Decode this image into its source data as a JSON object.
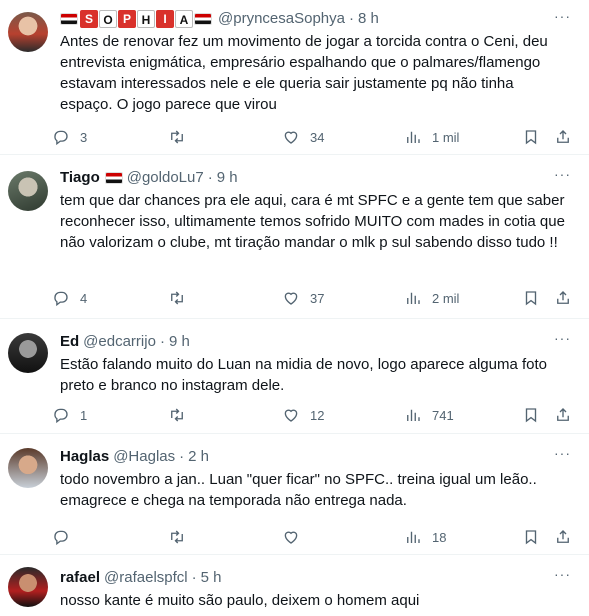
{
  "tweets": [
    {
      "name": "SOPHIA",
      "name_letters": [
        "S",
        "O",
        "P",
        "H",
        "I",
        "A"
      ],
      "handle": "@pryncesaSophya",
      "time": "8 h",
      "text": "Antes de renovar fez um movimento de jogar a torcida contra o Ceni, deu entrevista enigmática, empresário espalhando que o palmares/flamengo estavam interessados nele e ele queria sair justamente pq não tinha espaço. O jogo parece que virou",
      "replies": "3",
      "retweets": "",
      "likes": "34",
      "views": "1 mil"
    },
    {
      "name": "Tiago",
      "handle": "@goldoLu7",
      "time": "9 h",
      "text": "tem que dar chances pra ele aqui, cara é mt SPFC e a gente tem que saber reconhecer isso, ultimamente temos sofrido MUITO com mades in cotia que não valorizam o clube, mt tiração mandar o mlk p sul sabendo disso tudo !!",
      "replies": "4",
      "retweets": "",
      "likes": "37",
      "views": "2 mil"
    },
    {
      "name": "Ed",
      "handle": "@edcarrijo",
      "time": "9 h",
      "text": "Estão falando muito do Luan na midia de novo, logo aparece alguma foto preto e branco no instagram dele.",
      "replies": "1",
      "retweets": "",
      "likes": "12",
      "views": "741"
    },
    {
      "name": "Haglas",
      "handle": "@Haglas",
      "time": "2 h",
      "text": "todo novembro a jan.. Luan \"quer ficar\" no SPFC.. treina igual um leão.. emagrece e chega na temporada não entrega nada.",
      "replies": "",
      "retweets": "",
      "likes": "",
      "views": "18"
    },
    {
      "name": "rafael",
      "handle": "@rafaelspfcl",
      "time": "5 h",
      "text": "nosso kante é muito são paulo, deixem o homem aqui"
    }
  ],
  "separator": "·",
  "more_glyph": "···",
  "colors": {
    "text": "#0f1419",
    "muted": "#536471",
    "border": "#eff3f4",
    "flag_red": "#cc0000"
  }
}
